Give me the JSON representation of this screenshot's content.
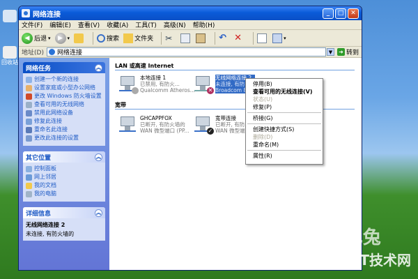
{
  "window": {
    "title": "网络连接"
  },
  "menu": [
    "文件(F)",
    "编辑(E)",
    "查看(V)",
    "收藏(A)",
    "工具(T)",
    "高级(N)",
    "帮助(H)"
  ],
  "toolbar": {
    "back": "后退",
    "search": "搜索",
    "folders": "文件夹"
  },
  "address": {
    "label": "地址(D)",
    "value": "网络连接",
    "go": "转到"
  },
  "tasks": {
    "title": "网络任务",
    "items": [
      "创建一个新的连接",
      "设置家庭或小型办公网络",
      "更改 Windows 防火墙设置",
      "查看可用的无线网络",
      "禁用此网络设备",
      "修复此连接",
      "重命名此连接",
      "更改此连接的设置"
    ]
  },
  "places": {
    "title": "其它位置",
    "items": [
      "控制面板",
      "网上邻居",
      "我的文档",
      "我的电脑"
    ]
  },
  "details": {
    "title": "详细信息",
    "name": "无线网络连接 2",
    "status": "未连接, 有防火墙的"
  },
  "groups": {
    "lan": "LAN 或高速 Internet",
    "broadband": "宽带"
  },
  "connections": [
    {
      "name": "本地连接 1",
      "status": "已禁用, 有防火...",
      "device": "Qualcomm Atheros..."
    },
    {
      "name": "无线网络连接 2",
      "status": "未连接, 有防...",
      "device": "Broadcom 80..."
    },
    {
      "name": "GHCAPPFOX",
      "status": "已断开, 有防火墙的",
      "device": "WAN 微型端口 (PP..."
    },
    {
      "name": "宽带连接",
      "status": "已断开, 有防火墙的",
      "device": "WAN 微型端口 (PP..."
    }
  ],
  "context_menu": [
    {
      "label": "停用(B)",
      "style": "normal"
    },
    {
      "label": "查看可用的无线连接(V)",
      "style": "bold"
    },
    {
      "label": "状态(U)",
      "style": "disabled"
    },
    {
      "label": "修复(P)",
      "style": "normal"
    },
    {
      "label": "桥接(G)",
      "style": "normal"
    },
    {
      "label": "创建快捷方式(S)",
      "style": "normal"
    },
    {
      "label": "删除(D)",
      "style": "disabled"
    },
    {
      "label": "重命名(M)",
      "style": "normal"
    },
    {
      "label": "属性(R)",
      "style": "normal"
    }
  ],
  "desktop": {
    "icon_label": "回收站"
  },
  "watermark": {
    "brand": "我爱IT技术网",
    "mark": "十巴兔"
  },
  "colors": {
    "titlebar": "#0a5bd8",
    "selection": "#316ac5",
    "link": "#215dc6"
  }
}
